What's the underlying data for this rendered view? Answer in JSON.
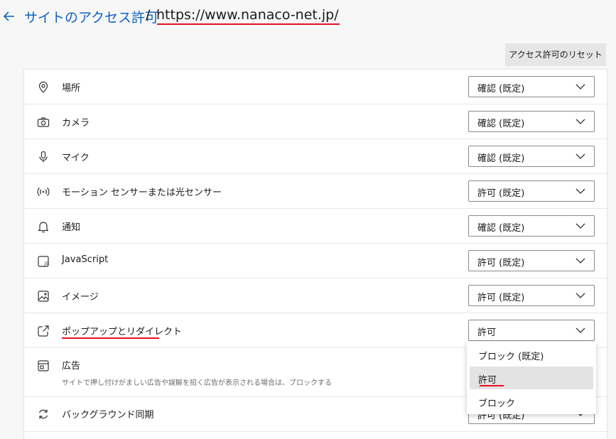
{
  "header": {
    "title": "サイトのアクセス許可",
    "separator": "/",
    "site_url": "https://www.nanaco-net.jp/"
  },
  "reset_button": "アクセス許可のリセット",
  "permissions": [
    {
      "label": "場所",
      "value": "確認 (既定)",
      "icon": "location-icon"
    },
    {
      "label": "カメラ",
      "value": "確認 (既定)",
      "icon": "camera-icon"
    },
    {
      "label": "マイク",
      "value": "確認 (既定)",
      "icon": "microphone-icon"
    },
    {
      "label": "モーション センサーまたは光センサー",
      "value": "許可 (既定)",
      "icon": "sensor-icon"
    },
    {
      "label": "通知",
      "value": "確認 (既定)",
      "icon": "bell-icon"
    },
    {
      "label": "JavaScript",
      "value": "許可 (既定)",
      "icon": "javascript-icon"
    },
    {
      "label": "イメージ",
      "value": "許可 (既定)",
      "icon": "image-icon"
    },
    {
      "label": "ポップアップとリダイレクト",
      "value": "許可",
      "icon": "popup-icon"
    },
    {
      "label": "広告",
      "sublabel": "サイトで押し付けがましい広告や誤解を招く広告が表示される場合は、ブロックする",
      "icon": "ads-icon"
    },
    {
      "label": "バックグラウンド同期",
      "value": "許可 (既定)",
      "icon": "sync-icon"
    }
  ],
  "dropdown": {
    "options": [
      "ブロック (既定)",
      "許可",
      "ブロック"
    ],
    "highlighted": "許可"
  },
  "colors": {
    "accent": "#0f62c0",
    "annotation_red": "#e81123"
  }
}
